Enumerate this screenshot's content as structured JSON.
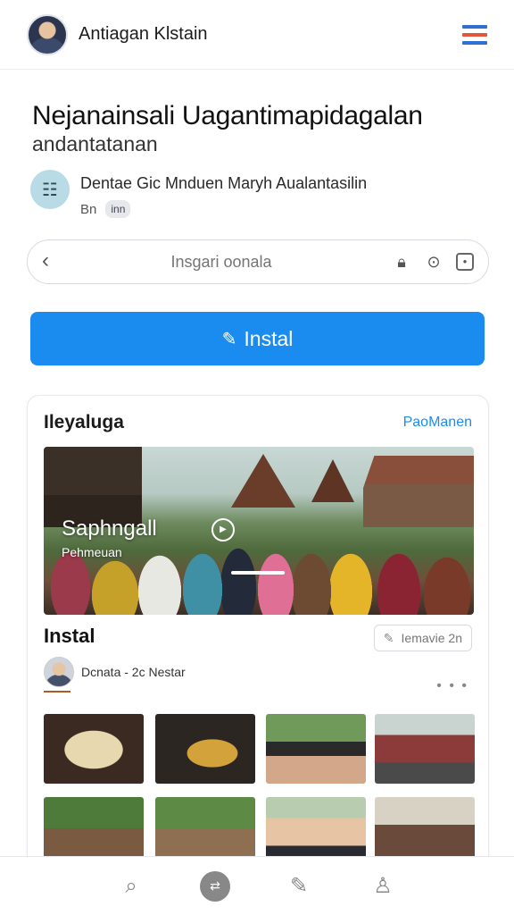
{
  "header": {
    "title": "Antiagan Klstain",
    "avatar_icon": "user-avatar",
    "menu_icon": "hamburger-menu-icon",
    "menu_colors": [
      "#2f6fd0",
      "#e2563a",
      "#2f6fd0"
    ]
  },
  "article": {
    "headline": "Nejanainsali Uagantimapidagalan",
    "subheadline": "andantatanan",
    "author_name": "Dentae Gic Mnduen Maryh Aualantasilin",
    "author_meta": "Bn",
    "author_badge": "inn"
  },
  "search": {
    "placeholder": "Insgari oonala"
  },
  "install_button": {
    "label": "Instal",
    "color": "#1a8cf0"
  },
  "card": {
    "title": "Ileyaluga",
    "link": "PaoManen",
    "hero": {
      "title": "Saphngall",
      "subtitle": "Pehmeuan"
    },
    "section_title": "Instal",
    "chip_label": "Iemavie 2n",
    "byline": "Dcnata - 2c Nestar",
    "more_label": "• • •"
  },
  "bottom_nav": {
    "items": [
      {
        "name": "search-icon",
        "glyph": "⌕"
      },
      {
        "name": "home-icon",
        "glyph": "⇄"
      },
      {
        "name": "message-icon",
        "glyph": "✎"
      },
      {
        "name": "profile-icon",
        "glyph": "♙"
      }
    ]
  }
}
